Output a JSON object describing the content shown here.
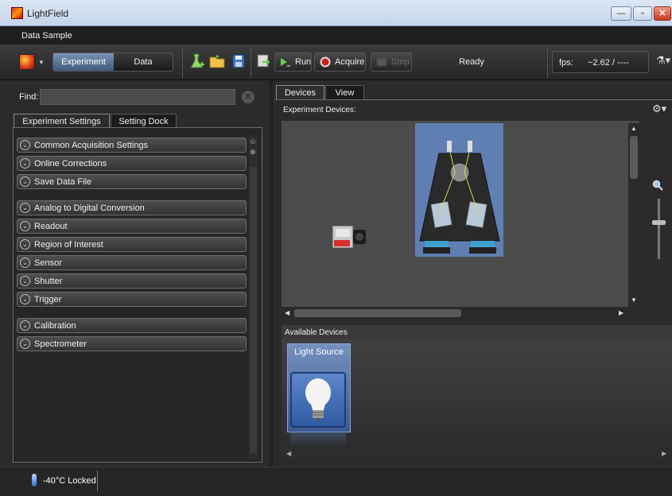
{
  "window": {
    "title": "LightField",
    "minimize": "—",
    "maximize": "▫",
    "close": "✕"
  },
  "menu": {
    "label": "Data Sample"
  },
  "toolbar": {
    "experiment_label": "Experiment",
    "data_label": "Data",
    "run_label": "Run",
    "acquire_label": "Acquire",
    "stop_label": "Stop",
    "status": "Ready",
    "fps_label": "fps:",
    "fps_value": "~2.62 / ----"
  },
  "left": {
    "find_label": "Find:",
    "tabs": [
      "Experiment Settings",
      "Setting Dock"
    ],
    "sections": [
      "Common Acquisition Settings",
      "Online Corrections",
      "Save Data File",
      "Analog to Digital Conversion",
      "Readout",
      "Region of Interest",
      "Sensor",
      "Shutter",
      "Trigger",
      "Calibration",
      "Spectrometer"
    ]
  },
  "right": {
    "tabs": [
      "Devices",
      "View"
    ],
    "experiment_devices_label": "Experiment Devices:",
    "available_devices_label": "Available Devices",
    "available": [
      {
        "label": "Light Source",
        "icon": "lightbulb-icon"
      }
    ]
  },
  "statusbar": {
    "temperature": "-40°C Locked"
  },
  "colors": {
    "accent": "#5f7fb3",
    "panel_bg": "#2b2b2b",
    "canvas_bg": "#4b4b4b"
  }
}
